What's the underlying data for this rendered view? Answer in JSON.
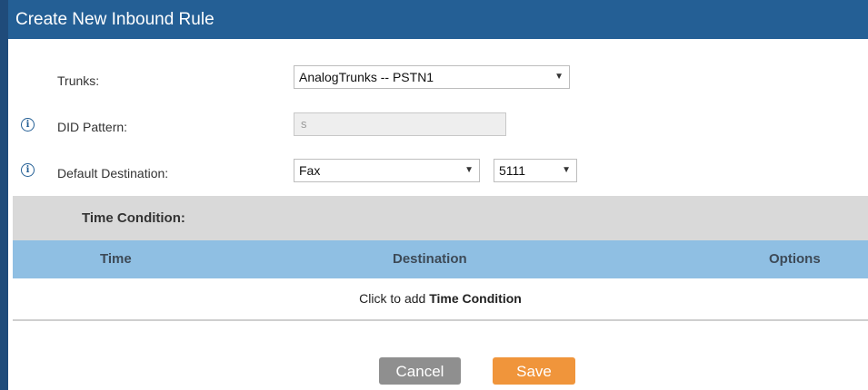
{
  "dialog": {
    "title": "Create New Inbound Rule"
  },
  "form": {
    "trunks": {
      "label": "Trunks:",
      "value": "AnalogTrunks -- PSTN1"
    },
    "did_pattern": {
      "label": "DID Pattern:",
      "value": "s"
    },
    "default_destination": {
      "label": "Default Destination:",
      "type_value": "Fax",
      "ext_value": "5111"
    }
  },
  "time_condition": {
    "title": "Time Condition:",
    "columns": [
      "Time",
      "Destination",
      "Options"
    ],
    "add_prefix": "Click to add",
    "add_link": "Time Condition"
  },
  "buttons": {
    "cancel": "Cancel",
    "save": "Save"
  },
  "icons": {
    "info": "info-icon",
    "dropdown": "chevron-down-icon"
  },
  "colors": {
    "title_bar": "#245f95",
    "save_button": "#f0953b",
    "cancel_button": "#8f8f8f",
    "table_header": "#8fbfe3"
  }
}
